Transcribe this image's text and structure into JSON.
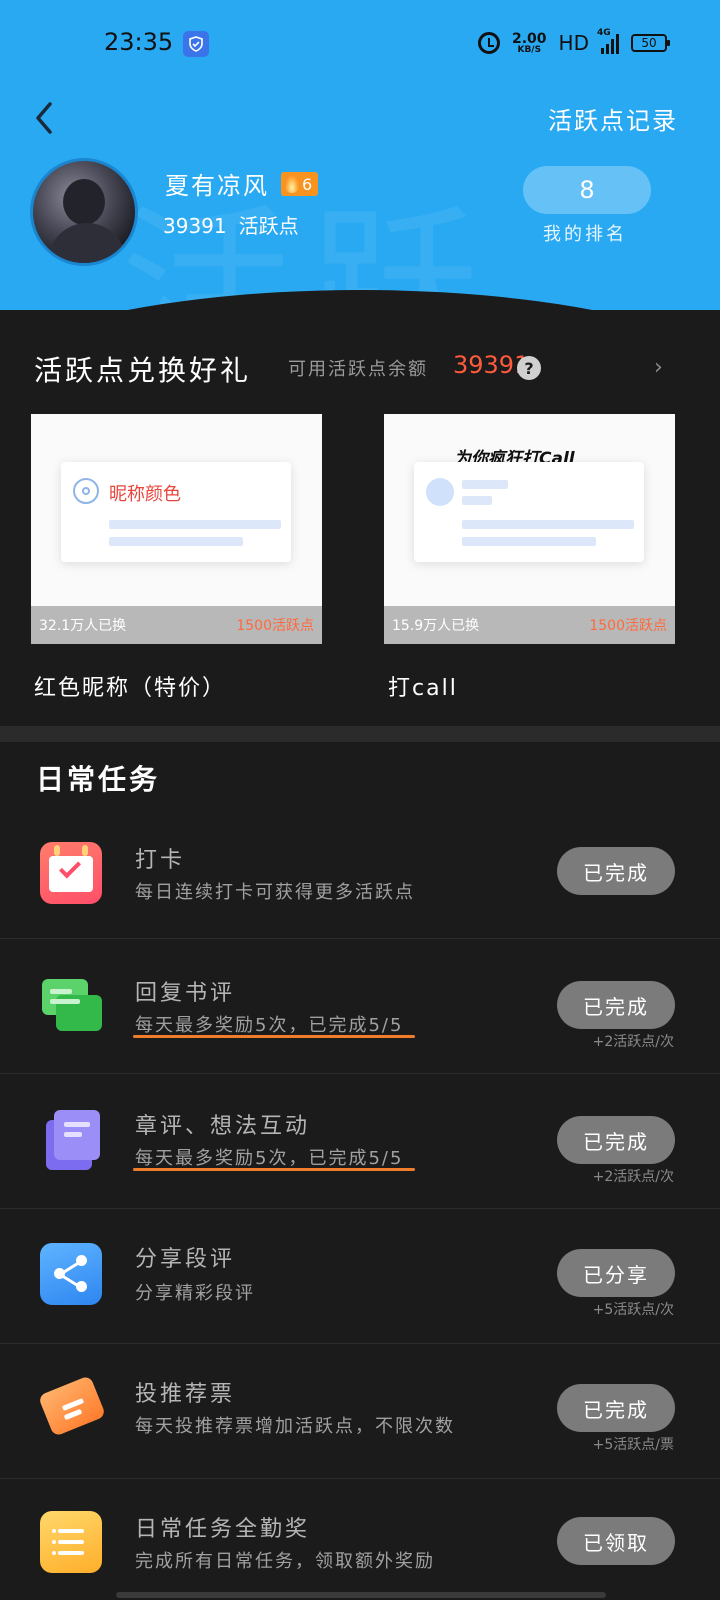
{
  "status_bar": {
    "time": "23:35",
    "net_speed": "2.00",
    "net_unit": "KB/S",
    "hd": "HD",
    "signal": "4G",
    "battery": "50"
  },
  "header": {
    "record_link": "活跃点记录",
    "username": "夏有凉风",
    "level": "6",
    "points": "39391",
    "points_label": "活跃点",
    "rank_value": "8",
    "rank_label": "我的排名",
    "watermark": "活跃",
    "colors": {
      "header_bg": "#2aa9f3",
      "accent_orange": "#f7931e"
    }
  },
  "exchange": {
    "title": "活跃点兑换好礼",
    "balance_label": "可用活跃点余额",
    "balance_value": "39391",
    "help": "?",
    "more": "›",
    "items": [
      {
        "preview_text": "昵称颜色",
        "exchanged": "32.1万人已换",
        "cost": "1500活跃点",
        "name": "红色昵称（特价）"
      },
      {
        "preview_text": "为你疯狂打Call",
        "exchanged": "15.9万人已换",
        "cost": "1500活跃点",
        "name": "打call"
      }
    ]
  },
  "tasks": {
    "title": "日常任务",
    "items": [
      {
        "icon": "calendar-check-icon",
        "name": "打卡",
        "desc": "每日连续打卡可获得更多活跃点",
        "button": "已完成",
        "reward": ""
      },
      {
        "icon": "chat-bubbles-icon",
        "name": "回复书评",
        "desc": "每天最多奖励5次，已完成5/5",
        "button": "已完成",
        "reward": "+2活跃点/次"
      },
      {
        "icon": "document-stack-icon",
        "name": "章评、想法互动",
        "desc": "每天最多奖励5次，已完成5/5",
        "button": "已完成",
        "reward": "+2活跃点/次"
      },
      {
        "icon": "share-icon",
        "name": "分享段评",
        "desc": "分享精彩段评",
        "button": "已分享",
        "reward": "+5活跃点/次"
      },
      {
        "icon": "ticket-icon",
        "name": "投推荐票",
        "desc": "每天投推荐票增加活跃点，不限次数",
        "button": "已完成",
        "reward": "+5活跃点/票"
      },
      {
        "icon": "list-icon",
        "name": "日常任务全勤奖",
        "desc": "完成所有日常任务，领取额外奖励",
        "button": "已领取",
        "reward": ""
      }
    ]
  }
}
